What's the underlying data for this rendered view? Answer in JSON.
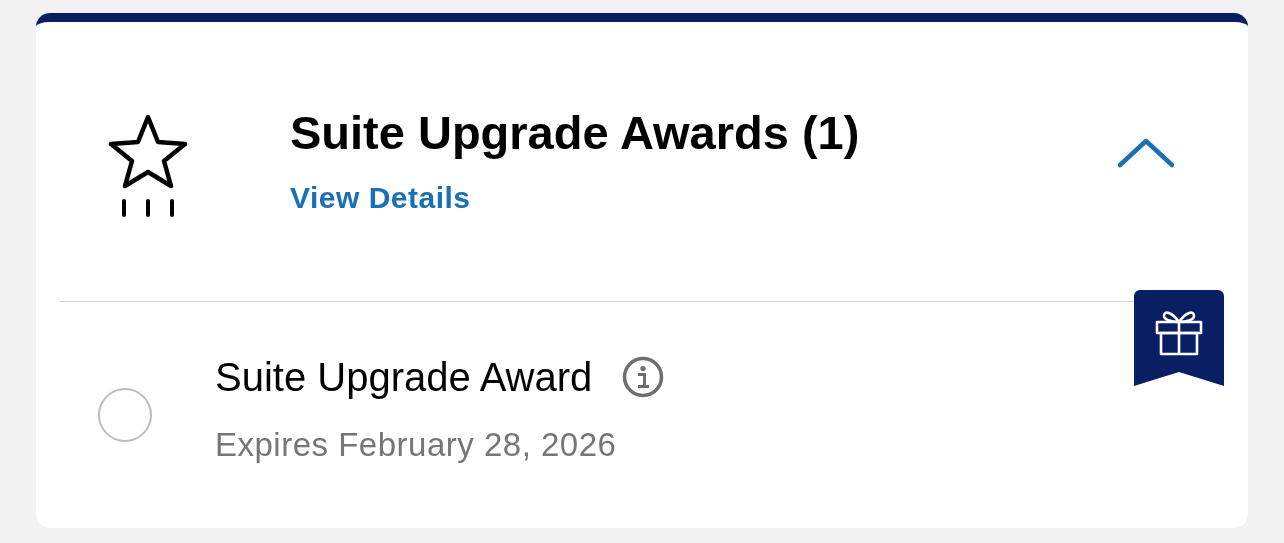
{
  "section": {
    "title": "Suite Upgrade Awards (1)",
    "link": "View Details",
    "expanded": true
  },
  "awards": [
    {
      "name": "Suite Upgrade Award",
      "expiry": "Expires February 28, 2026",
      "selected": false
    }
  ]
}
